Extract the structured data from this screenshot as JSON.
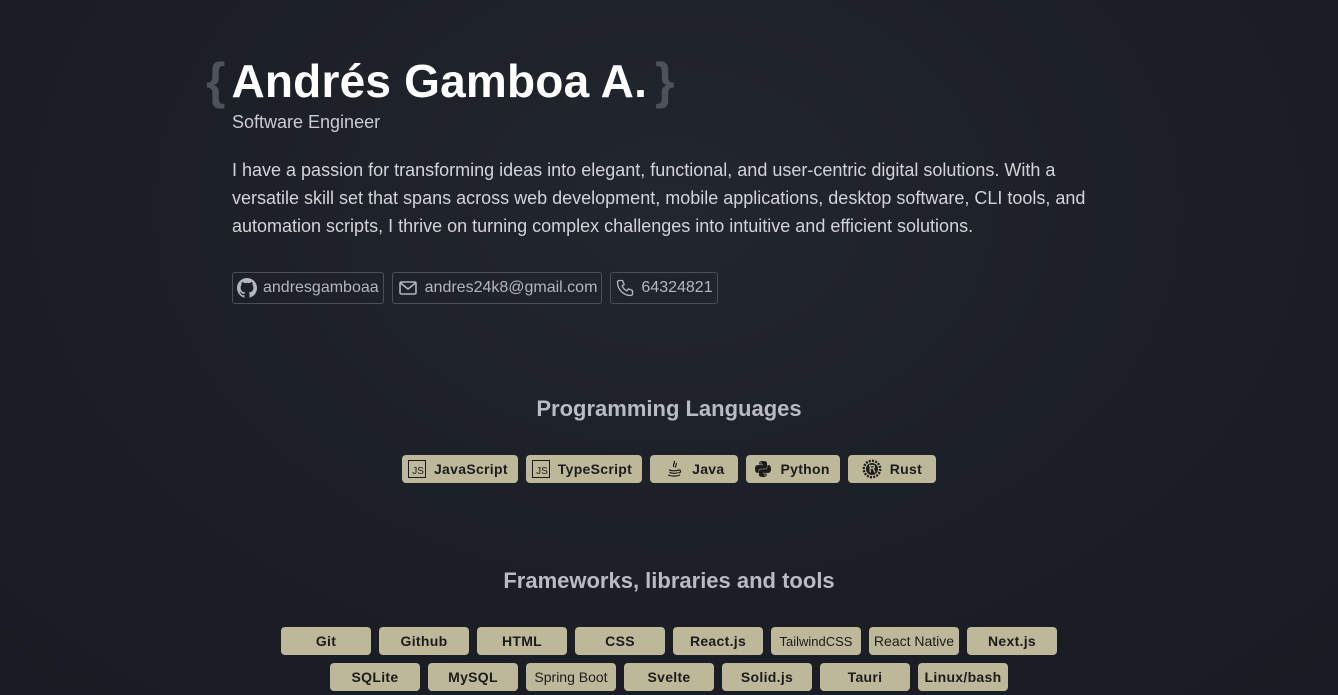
{
  "header": {
    "brace_open": "{",
    "name": "Andrés Gamboa A.",
    "brace_close": "}",
    "role": "Software Engineer"
  },
  "bio": "I have a passion for transforming ideas into elegant, functional, and user-centric digital solutions. With a versatile skill set that spans across web development, mobile applications, desktop software, CLI tools, and automation scripts, I thrive on turning complex challenges into intuitive and efficient solutions.",
  "contacts": {
    "github": {
      "label": "andresgamboaa",
      "icon": "github-icon"
    },
    "email": {
      "label": "andres24k8@gmail.com",
      "icon": "mail-icon"
    },
    "phone": {
      "label": "64324821",
      "icon": "phone-icon"
    }
  },
  "languages": {
    "title": "Programming Languages",
    "items": [
      {
        "label": "JavaScript",
        "icon": "javascript-icon",
        "icon_text": "JS"
      },
      {
        "label": "TypeScript",
        "icon": "typescript-icon",
        "icon_text": "JS"
      },
      {
        "label": "Java",
        "icon": "java-icon"
      },
      {
        "label": "Python",
        "icon": "python-icon"
      },
      {
        "label": "Rust",
        "icon": "rust-icon"
      }
    ]
  },
  "tools": {
    "title": "Frameworks, libraries and tools",
    "row1": [
      "Git",
      "Github",
      "HTML",
      "CSS",
      "React.js",
      "TailwindCSS",
      "React Native",
      "Next.js"
    ],
    "row2": [
      "SQLite",
      "MySQL",
      "Spring Boot",
      "Svelte",
      "Solid.js",
      "Tauri",
      "Linux/bash"
    ]
  },
  "colors": {
    "background": "#1b1e25",
    "chip": "#bdb89a",
    "name": "#ffffff",
    "brace": "#4d525b"
  }
}
